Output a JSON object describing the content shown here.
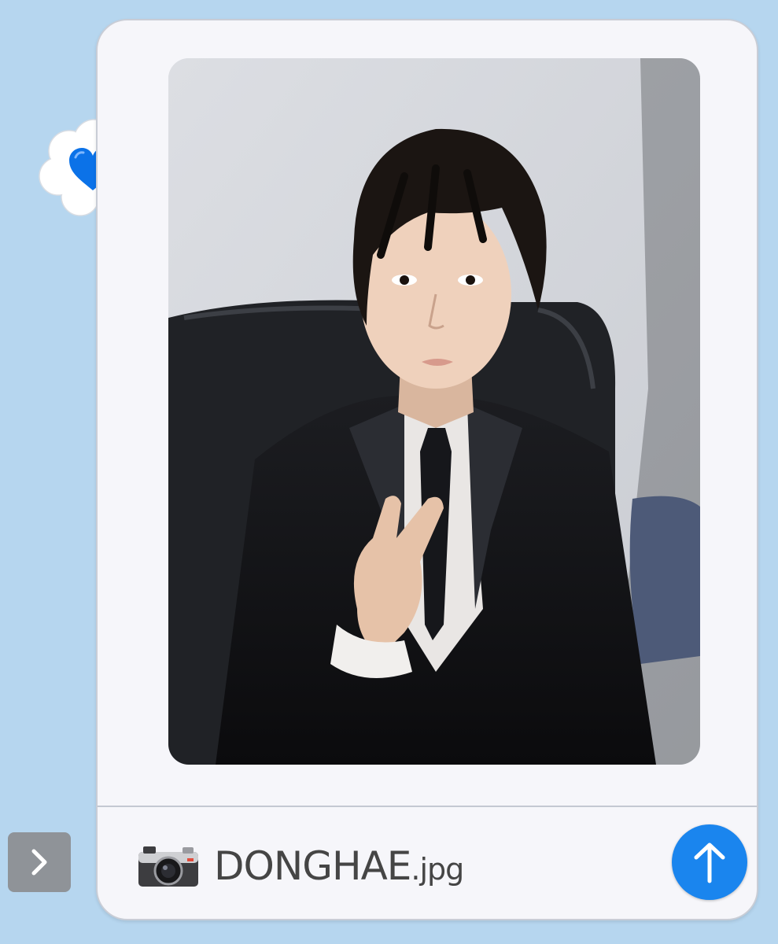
{
  "message": {
    "attachment": {
      "file_name": "DONGHAE",
      "file_ext": ".jpg",
      "icon": "camera-icon"
    }
  },
  "reaction": {
    "icon": "blue-heart-icon",
    "bubble": "thought-bubble"
  },
  "controls": {
    "send_icon": "arrow-up-icon",
    "expand_icon": "chevron-right-icon"
  },
  "colors": {
    "background": "#b6d6ef",
    "card": "#f6f6fa",
    "send_button": "#1a85ee",
    "heart": "#0b72e8",
    "expand_button": "#8f9398"
  }
}
